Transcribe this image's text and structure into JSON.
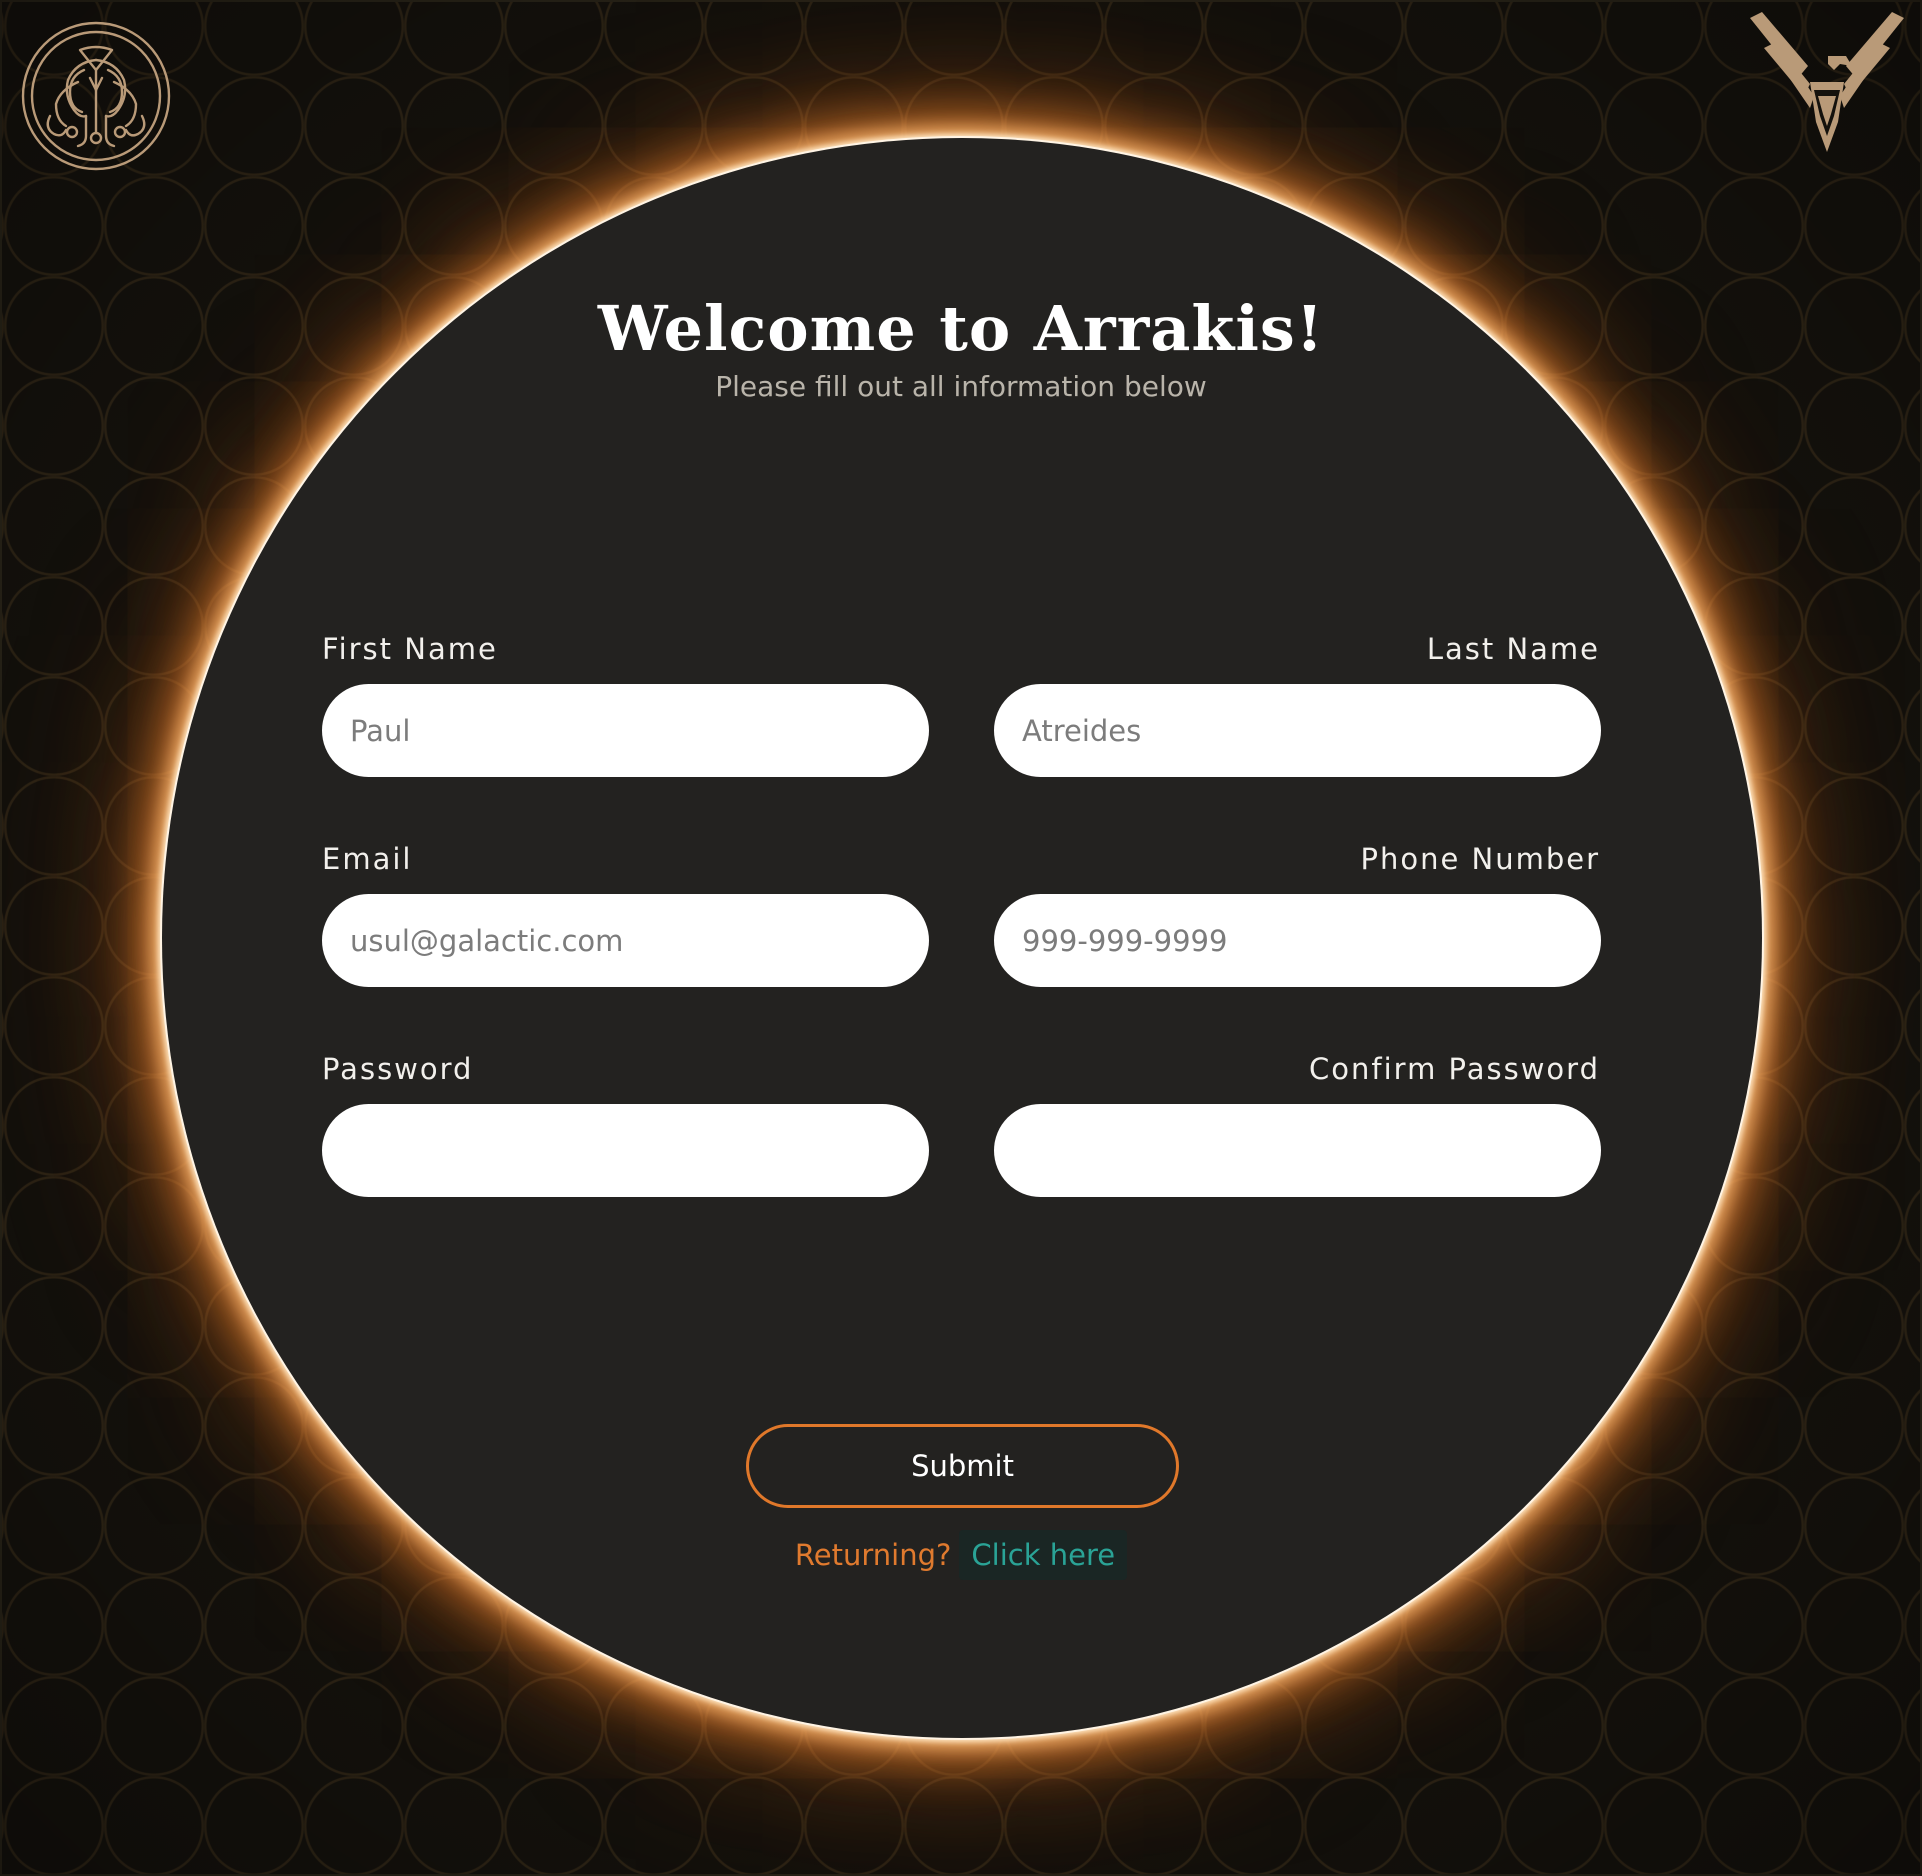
{
  "header": {
    "title": "Welcome to Arrakis!",
    "subtitle": "Please fill out all information below"
  },
  "logos": {
    "left_icon": "atreides-hawk-seal-icon",
    "right_icon": "harkonnen-griffin-icon",
    "color": "#b99a78"
  },
  "form": {
    "first_name": {
      "label": "First Name",
      "placeholder": "Paul"
    },
    "last_name": {
      "label": "Last Name",
      "placeholder": "Atreides"
    },
    "email": {
      "label": "Email",
      "placeholder": "usul@galactic.com"
    },
    "phone": {
      "label": "Phone Number",
      "placeholder": "999-999-9999"
    },
    "password": {
      "label": "Password",
      "placeholder": ""
    },
    "confirm_password": {
      "label": "Confirm Password",
      "placeholder": ""
    },
    "submit_label": "Submit"
  },
  "footer": {
    "returning_text": "Returning?",
    "link_text": "Click here"
  },
  "colors": {
    "background": "#15120d",
    "panel": "#232220",
    "glow": "#f08c37",
    "accent_orange": "#e0782a",
    "link_teal": "#2aa396"
  }
}
